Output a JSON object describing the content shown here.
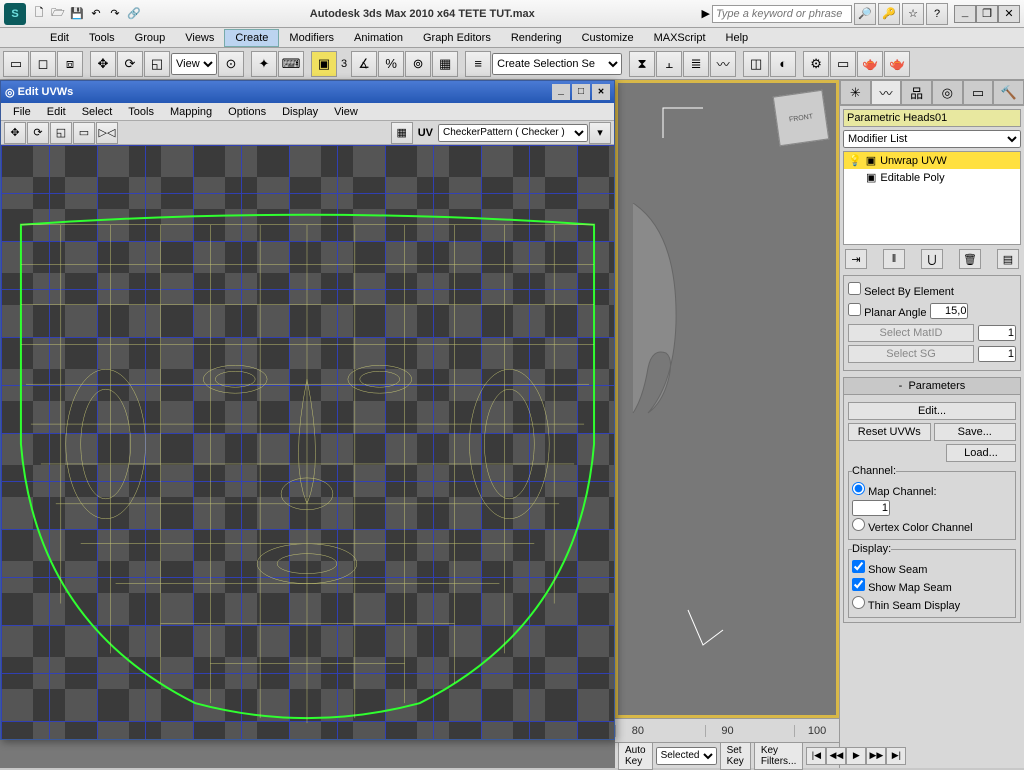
{
  "app": {
    "title": "Autodesk 3ds Max  2010 x64      TETE TUT.max",
    "search_placeholder": "Type a keyword or phrase"
  },
  "qat": {
    "new": "🗋",
    "open": "🗁",
    "save": "💾",
    "undo": "↶",
    "redo": "↷",
    "link": "🔗"
  },
  "menubar": [
    "Edit",
    "Tools",
    "Group",
    "Views",
    "Create",
    "Modifiers",
    "Animation",
    "Graph Editors",
    "Rendering",
    "Customize",
    "MAXScript",
    "Help"
  ],
  "menubar_active": "Create",
  "toolbar": {
    "view_label": "View",
    "selset_label": "Create Selection Se",
    "snap_angle": "3"
  },
  "viewport": {
    "cube_face": "FRONT",
    "timeline_ticks": [
      "80",
      "",
      "90",
      "",
      "100"
    ]
  },
  "bottom": {
    "autokey": "Auto Key",
    "setkey": "Set Key",
    "selected": "Selected",
    "keyfilters": "Key Filters..."
  },
  "panel": {
    "object_name": "Parametric Heads01",
    "modifier_list_label": "Modifier List",
    "stack": [
      {
        "label": "Unwrap UVW",
        "selected": true
      },
      {
        "label": "Editable Poly",
        "selected": false
      }
    ],
    "sel_rollout": {
      "select_by_element": "Select By Element",
      "planar_angle": "Planar Angle",
      "planar_value": "15,0",
      "select_matid": "Select MatID",
      "matid_value": "1",
      "select_sg": "Select SG",
      "sg_value": "1"
    },
    "param_rollout": {
      "header": "Parameters",
      "edit": "Edit...",
      "reset": "Reset UVWs",
      "save": "Save...",
      "load": "Load...",
      "channel_hdr": "Channel:",
      "map_channel": "Map Channel:",
      "map_value": "1",
      "vertex_color": "Vertex Color Channel",
      "display_hdr": "Display:",
      "show_seam": "Show Seam",
      "show_map_seam": "Show Map Seam",
      "thin_seam": "Thin Seam Display"
    }
  },
  "uvw": {
    "title": "Edit UVWs",
    "menu": [
      "File",
      "Edit",
      "Select",
      "Tools",
      "Mapping",
      "Options",
      "Display",
      "View"
    ],
    "uv_label": "UV",
    "dropdown": "CheckerPattern  ( Checker )"
  }
}
